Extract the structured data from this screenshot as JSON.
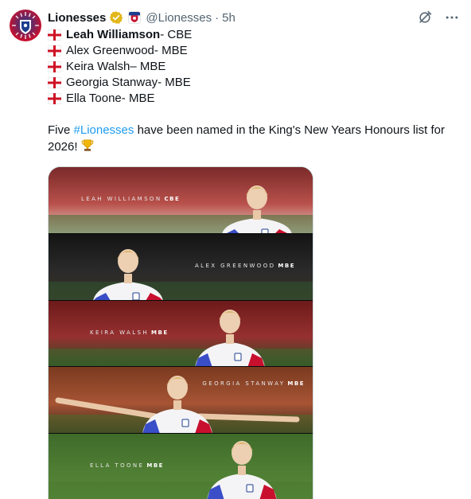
{
  "account": {
    "display_name": "Lionesses",
    "handle": "@Lionesses",
    "separator": "·",
    "time": "5h"
  },
  "icons": {
    "verified": "verified-badge-icon",
    "affiliate": "affiliate-badge-icon",
    "grok": "grok-icon",
    "more": "more-icon",
    "flag": "england-flag-icon",
    "trophy": "trophy-icon"
  },
  "honours": [
    {
      "name": "Leah Williamson",
      "award": " - CBE"
    },
    {
      "name": "Alex Greenwood",
      "award": " - MBE"
    },
    {
      "name": "Keira Walsh",
      "award": " – MBE"
    },
    {
      "name": "Georgia Stanway",
      "award": " - MBE"
    },
    {
      "name": "Ella Toone",
      "award": " - MBE"
    }
  ],
  "message": {
    "before": "Five ",
    "hashtag": "#Lionesses",
    "after": " have been named in the King's New Years Honours list for 2026!"
  },
  "media_panels": [
    {
      "name": "LEAH WILLIAMSON",
      "award": "CBE"
    },
    {
      "name": "ALEX GREENWOOD",
      "award": "MBE"
    },
    {
      "name": "KEIRA WALSH",
      "award": "MBE"
    },
    {
      "name": "GEORGIA STANWAY",
      "award": "MBE"
    },
    {
      "name": "ELLA TOONE",
      "award": "MBE"
    }
  ],
  "colors": {
    "text": "#0f1419",
    "secondary": "#536471",
    "link": "#1d9bf0",
    "verified_gold": "#e2b719",
    "england_red": "#ce1124"
  }
}
